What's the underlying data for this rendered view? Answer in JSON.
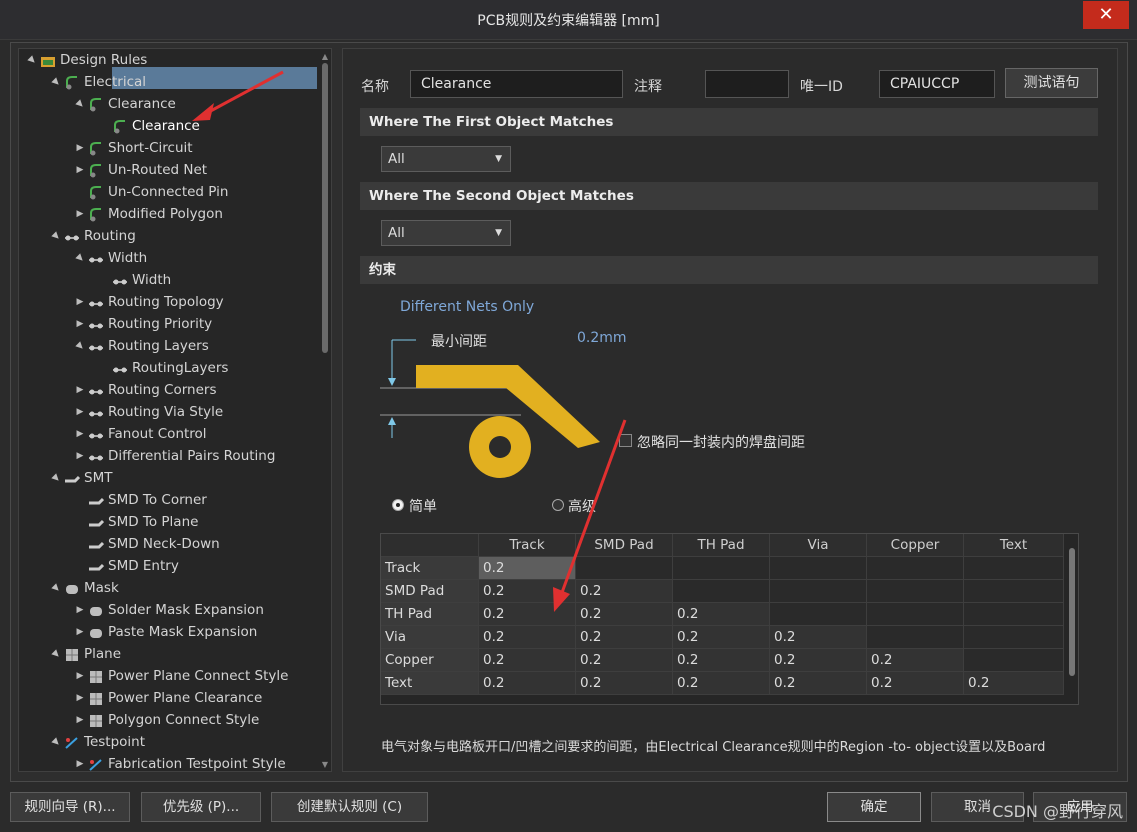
{
  "window": {
    "title": "PCB规则及约束编辑器 [mm]",
    "close_glyph": "✕"
  },
  "tree": {
    "items": [
      {
        "label": "Design Rules",
        "expander": "▲"
      },
      {
        "label": "Electrical",
        "expander": "▲"
      },
      {
        "label": "Clearance",
        "expander": "▲"
      },
      {
        "label": "Clearance",
        "expander": ""
      },
      {
        "label": "Short-Circuit",
        "expander": "▶"
      },
      {
        "label": "Un-Routed Net",
        "expander": "▶"
      },
      {
        "label": "Un-Connected Pin",
        "expander": ""
      },
      {
        "label": "Modified Polygon",
        "expander": "▶"
      },
      {
        "label": "Routing",
        "expander": "▲"
      },
      {
        "label": "Width",
        "expander": "▲"
      },
      {
        "label": "Width",
        "expander": ""
      },
      {
        "label": "Routing Topology",
        "expander": "▶"
      },
      {
        "label": "Routing Priority",
        "expander": "▶"
      },
      {
        "label": "Routing Layers",
        "expander": "▲"
      },
      {
        "label": "RoutingLayers",
        "expander": ""
      },
      {
        "label": "Routing Corners",
        "expander": "▶"
      },
      {
        "label": "Routing Via Style",
        "expander": "▶"
      },
      {
        "label": "Fanout Control",
        "expander": "▶"
      },
      {
        "label": "Differential Pairs Routing",
        "expander": "▶"
      },
      {
        "label": "SMT",
        "expander": "▲"
      },
      {
        "label": "SMD To Corner",
        "expander": ""
      },
      {
        "label": "SMD To Plane",
        "expander": ""
      },
      {
        "label": "SMD Neck-Down",
        "expander": ""
      },
      {
        "label": "SMD Entry",
        "expander": ""
      },
      {
        "label": "Mask",
        "expander": "▲"
      },
      {
        "label": "Solder Mask Expansion",
        "expander": "▶"
      },
      {
        "label": "Paste Mask Expansion",
        "expander": "▶"
      },
      {
        "label": "Plane",
        "expander": "▲"
      },
      {
        "label": "Power Plane Connect Style",
        "expander": "▶"
      },
      {
        "label": "Power Plane Clearance",
        "expander": "▶"
      },
      {
        "label": "Polygon Connect Style",
        "expander": "▶"
      },
      {
        "label": "Testpoint",
        "expander": "▲"
      },
      {
        "label": "Fabrication Testpoint Style",
        "expander": "▶"
      }
    ]
  },
  "rule": {
    "name_label": "名称",
    "name_value": "Clearance",
    "comment_label": "注释",
    "comment_value": "",
    "uid_label": "唯一ID",
    "uid_value": "CPAIUCCP",
    "test_button": "测试语句"
  },
  "first_match": {
    "header": "Where The First Object Matches",
    "selected": "All"
  },
  "second_match": {
    "header": "Where The Second Object Matches",
    "selected": "All"
  },
  "constraints": {
    "header": "约束",
    "net_scope": "Different Nets Only",
    "min_clearance_label": "最小间距",
    "min_clearance_value": "0.2mm",
    "ignore_pad_label": "忽略同一封装内的焊盘间距",
    "mode_simple": "简单",
    "mode_advanced": "高级"
  },
  "matrix": {
    "columns": [
      "Track",
      "SMD Pad",
      "TH Pad",
      "Via",
      "Copper",
      "Text"
    ],
    "rows": [
      {
        "name": "Track",
        "values": [
          "0.2",
          "",
          "",
          "",
          "",
          ""
        ]
      },
      {
        "name": "SMD Pad",
        "values": [
          "0.2",
          "0.2",
          "",
          "",
          "",
          ""
        ]
      },
      {
        "name": "TH Pad",
        "values": [
          "0.2",
          "0.2",
          "0.2",
          "",
          "",
          ""
        ]
      },
      {
        "name": "Via",
        "values": [
          "0.2",
          "0.2",
          "0.2",
          "0.2",
          "",
          ""
        ]
      },
      {
        "name": "Copper",
        "values": [
          "0.2",
          "0.2",
          "0.2",
          "0.2",
          "0.2",
          ""
        ]
      },
      {
        "name": "Text",
        "values": [
          "0.2",
          "0.2",
          "0.2",
          "0.2",
          "0.2",
          "0.2"
        ]
      }
    ]
  },
  "description": "电气对象与电路板开口/凹槽之间要求的间距，由Electrical Clearance规则中的Region -to- object设置以及Board",
  "footer": {
    "rule_wizard": "规则向导 (R)...",
    "priority": "优先级 (P)...",
    "create_default": "创建默认规则 (C)",
    "ok": "确定",
    "cancel": "取消",
    "apply": "应用"
  },
  "watermark": "CSDN @野行穿风",
  "colors": {
    "selection": "#5a7a99",
    "copper": "#e2b020",
    "annotation_arrow": "#e03030",
    "close_button": "#c42b1c"
  }
}
